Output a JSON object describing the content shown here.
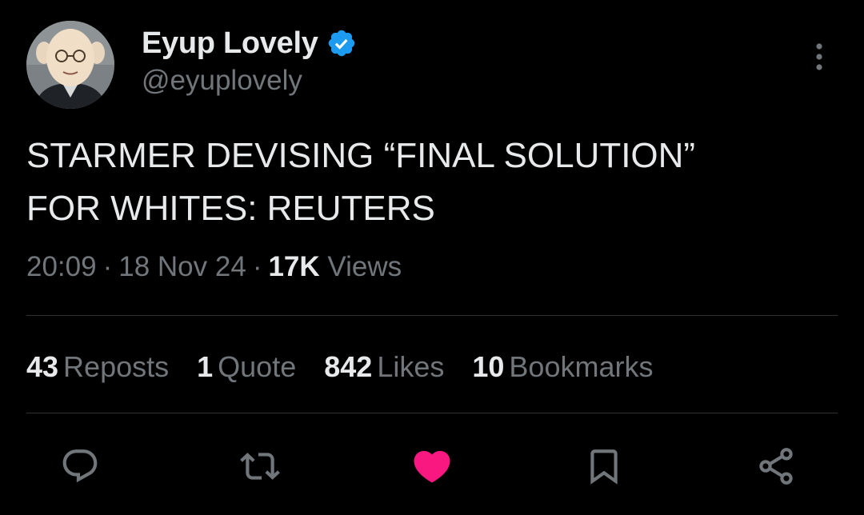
{
  "author": {
    "display_name": "Eyup Lovely",
    "handle": "@eyuplovely",
    "verified": true,
    "avatar": "avatar-photo"
  },
  "post": {
    "text_line1": "STARMER DEVISING “FINAL SOLUTION”",
    "text_line2": "FOR WHITES: REUTERS",
    "time": "20:09",
    "separator": "·",
    "date": "18 Nov 24",
    "views_count": "17K",
    "views_label": "Views"
  },
  "stats": {
    "reposts_count": "43",
    "reposts_label": "Reposts",
    "quotes_count": "1",
    "quotes_label": "Quote",
    "likes_count": "842",
    "likes_label": "Likes",
    "bookmarks_count": "10",
    "bookmarks_label": "Bookmarks"
  },
  "actions": {
    "icons": [
      "reply-icon",
      "repost-icon",
      "like-icon",
      "bookmark-icon",
      "share-icon"
    ],
    "liked": true
  },
  "colors": {
    "background": "#000000",
    "text_primary": "#e7e9ea",
    "text_secondary": "#71767b",
    "divider": "#2f3336",
    "verified_blue": "#1d9bf0",
    "like_pink": "#f91880"
  }
}
